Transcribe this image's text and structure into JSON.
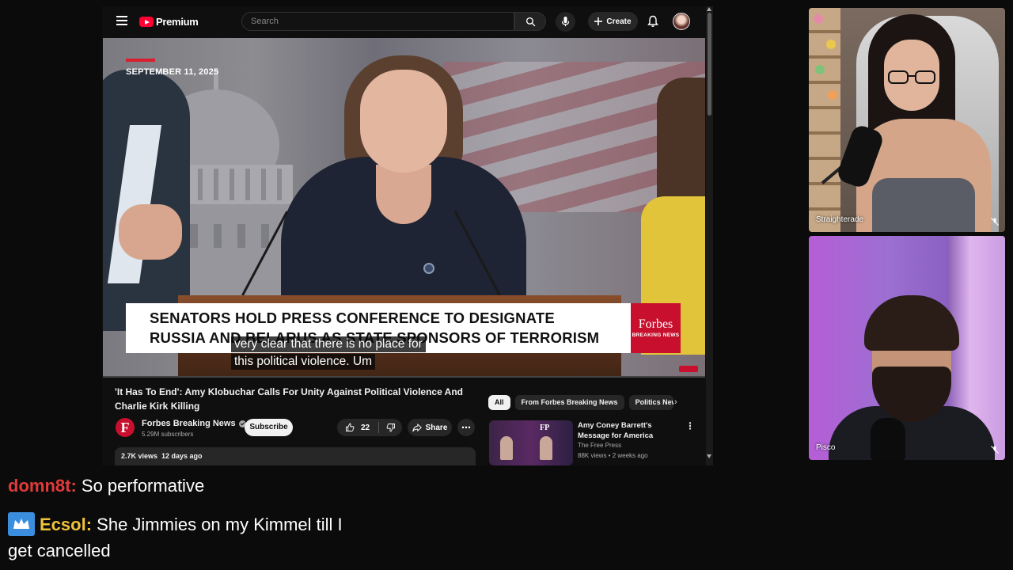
{
  "youtube": {
    "logo_text": "Premium",
    "search_placeholder": "Search",
    "create_label": "Create",
    "video": {
      "date_text": "SEPTEMBER 11, 2025",
      "lower_third_line1": "SENATORS HOLD PRESS CONFERENCE TO DESIGNATE",
      "lower_third_line2": "RUSSIA AND BELARUS AS STATE SPONSORS OF TERRORISM",
      "forbes_word": "Forbes",
      "forbes_sub": "BREAKING NEWS",
      "caption_line1": "very clear that there is no place for",
      "caption_line2": "this political violence. Um"
    },
    "title": "'It Has To End': Amy Klobuchar Calls For Unity Against Political Violence And Charlie Kirk Killing",
    "channel": {
      "logo_letter": "F",
      "name": "Forbes Breaking News",
      "subscribers": "5.29M subscribers",
      "subscribe_label": "Subscribe"
    },
    "likes": "22",
    "share_label": "Share",
    "description_meta": "2.7K views  12 days ago",
    "chips": [
      "All",
      "From Forbes Breaking News",
      "Politics News"
    ],
    "recommendation": {
      "thumb_badge": "FP",
      "title": "Amy Coney Barrett's Message for America",
      "channel": "The Free Press",
      "meta": "88K views • 2 weeks ago"
    }
  },
  "webcams": [
    {
      "label": "Straighterade"
    },
    {
      "label": "Pisco"
    }
  ],
  "chat": [
    {
      "user": "domn8t:",
      "user_color": "#e03a3a",
      "text": "So performative"
    },
    {
      "user": "Ecsol:",
      "user_color": "#f0c23a",
      "text": "She Jimmies on my Kimmel till I",
      "text_cont": "get cancelled",
      "badge": "crown-icon"
    }
  ]
}
